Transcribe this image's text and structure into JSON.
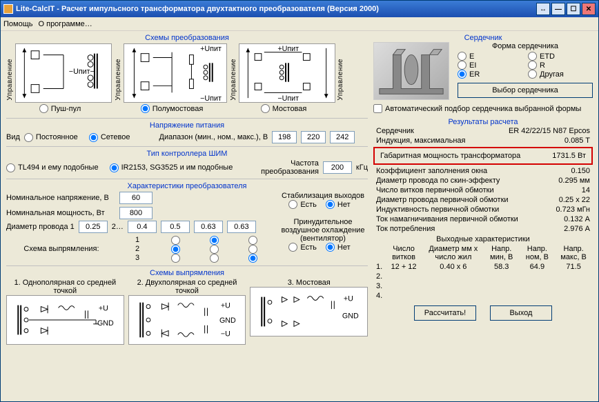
{
  "title": "Lite-CalcIT - Расчет импульсного трансформатора двухтактного преобразователя (Версия 2000)",
  "menu": {
    "help": "Помощь",
    "about": "О программе…"
  },
  "sections": {
    "topologies": "Схемы преобразования",
    "supply": "Напряжение питания",
    "controller": "Тип контроллера ШИМ",
    "characteristics": "Характеристики преобразователя",
    "rectifier": "Схемы выпрямления",
    "core": "Сердечник",
    "core_shape": "Форма сердечника",
    "results": "Результаты расчета",
    "out_chars": "Выходные характеристики"
  },
  "topology": {
    "vlabel": "Управление",
    "upos": "+Uпит",
    "uneg": "−Uпит",
    "opts": {
      "push": "Пуш-пул",
      "half": "Полумостовая",
      "full": "Мостовая"
    }
  },
  "supply": {
    "type_label": "Вид",
    "dc": "Постоянное",
    "ac": "Сетевое",
    "range_label": "Диапазон (мин., ном., макс.), В",
    "min": "198",
    "nom": "220",
    "max": "242"
  },
  "controller": {
    "tl494": "TL494 и ему подобные",
    "ir2153": "IR2153, SG3525 и им подобные",
    "freq_label": "Частота преобразования",
    "freq": "200",
    "freq_unit": "кГц"
  },
  "chars": {
    "nom_voltage_label": "Номинальное напряжение, В",
    "nom_voltage": "60",
    "nom_power_label": "Номинальная мощность, Вт",
    "nom_power": "800",
    "wire_diam_label": "Диаметр провода  1",
    "wire_diam_suffix": "2…",
    "d1": "0.25",
    "d2": "0.4",
    "d3": "0.5",
    "d4": "0.63",
    "d5": "0.63",
    "rect_scheme_label": "Схема выпрямления:",
    "idx1": "1",
    "idx2": "2",
    "idx3": "3",
    "stabilization": "Стабилизация выходов",
    "yes": "Есть",
    "no": "Нет",
    "cooling": "Принудительное воздушное охлаждение (вентилятор)"
  },
  "rect": {
    "t1": "1. Однополярная со средней точкой",
    "t2": "2. Двухполярная со средней точкой",
    "t3": "3. Мостовая",
    "u": "+U",
    "un": "−U",
    "gnd": "GND"
  },
  "core": {
    "e": "E",
    "etd": "ETD",
    "ei": "EI",
    "r": "R",
    "er": "ER",
    "other": "Другая",
    "select_btn": "Выбор сердечника",
    "auto": "Автоматический подбор сердечника выбранной формы"
  },
  "results": {
    "core_label": "Сердечник",
    "core_val": "ER 42/22/15 N87 Epcos",
    "b_label": "Индукция, максимальная",
    "b_val": "0.085 T",
    "gab_label": "Габаритная мощность трансформатора",
    "gab_val": "1731.5 Вт",
    "fill_label": "Коэффициент заполнения окна",
    "fill_val": "0.150",
    "skin_label": "Диаметр провода по скин-эффекту",
    "skin_val": "0.295 мм",
    "turns_label": "Число витков первичной обмотки",
    "turns_val": "14",
    "pwire_label": "Диаметр провода первичной обмотки",
    "pwire_val": "0.25 х 22",
    "ind_label": "Индуктивность первичной обмотки",
    "ind_val": "0.723 мГн",
    "imag_label": "Ток намагничивания первичной обмотки",
    "imag_val": "0.132 А",
    "icc_label": "Ток потребления",
    "icc_val": "2.976 А"
  },
  "out": {
    "h1": "Число витков",
    "h2": "Диаметр мм х число жил",
    "h3": "Напр. мин, В",
    "h4": "Напр. ном, В",
    "h5": "Напр. макс, В",
    "r1": {
      "n": "1.",
      "turns": "12 + 12",
      "wire": "0.40 х 6",
      "vmin": "58.3",
      "vnom": "64.9",
      "vmax": "71.5"
    },
    "r2": {
      "n": "2."
    },
    "r3": {
      "n": "3."
    },
    "r4": {
      "n": "4."
    }
  },
  "buttons": {
    "calc": "Рассчитать!",
    "exit": "Выход"
  }
}
